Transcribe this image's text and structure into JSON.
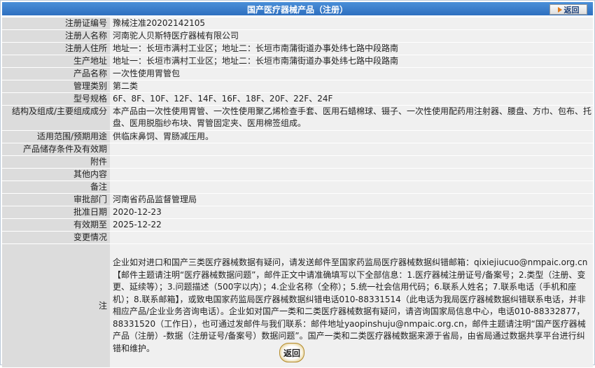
{
  "header": {
    "title": "国产医疗器械产品（注册）",
    "back_label": "返回"
  },
  "rows": [
    {
      "label": "注册证编号",
      "value": "豫械注准20202142105"
    },
    {
      "label": "注册人名称",
      "value": "河南驼人贝斯特医疗器械有限公司"
    },
    {
      "label": "注册人住所",
      "value": "地址一：长垣市满村工业区；地址二：长垣市南蒲街道办事处纬七路中段路南"
    },
    {
      "label": "生产地址",
      "value": "地址一：长垣市满村工业区；地址二：长垣市南蒲街道办事处纬七路中段路南"
    },
    {
      "label": "产品名称",
      "value": "一次性使用胃管包"
    },
    {
      "label": "管理类别",
      "value": "第二类"
    },
    {
      "label": "型号规格",
      "value": "6F、8F、10F、12F、14F、16F、18F、20F、22F、24F"
    },
    {
      "label": "结构及组成/主要组成成分",
      "value": "本产品由一次性使用胃管、一次性使用聚乙烯检查手套、医用石蜡棉球、镊子、一次性使用配药用注射器、腰盘、方巾、包布、托盘、医用脱脂纱布块、胃管固定夹、医用棉签组成。"
    },
    {
      "label": "适用范围/预期用途",
      "value": "供临床鼻饲、胃肠减压用。"
    },
    {
      "label": "产品储存条件及有效期",
      "value": ""
    },
    {
      "label": "附件",
      "value": ""
    },
    {
      "label": "其他内容",
      "value": ""
    },
    {
      "label": "备注",
      "value": ""
    },
    {
      "label": "审批部门",
      "value": "河南省药品监督管理局"
    },
    {
      "label": "批准日期",
      "value": "2020-12-23"
    },
    {
      "label": "有效期至",
      "value": "2025-12-22"
    },
    {
      "label": "变更情况",
      "value": ""
    }
  ],
  "note": {
    "label": "注",
    "text": "企业如对进口和国产三类医疗器械数据有疑问，请发送邮件至国家药监局医疗器械数据纠错邮箱：qixiejiucuo@nmpaic.org.cn【邮件主题请注明“医疗器械数据问题”，邮件正文中请准确填写以下全部信息：1.医疗器械注册证号/备案号；2.类型（注册、变更、延续等）；3.问题描述（500字以内）；4.企业名称（全称）；5.统一社会信用代码；6.联系人姓名；7.联系电话（手机和座机）；8.联系邮箱】，或致电国家药监局医疗器械数据纠错电话010-88331514（此电话为我局医疗器械数据纠错联系电话，并非相应产品/企业业务咨询电话）。企业如对国产一类和二类医疗器械数据有疑问，请咨询国家局信息中心，电话010-88332877，88331520（工作日），也可通过发邮件与我们联系：邮件地址yaopinshuju@nmpaic.org.cn，邮件主题请注明“国产医疗器械产品（注册）-数据（注册证号/备案号）数据问题”。国产一类和二类医疗器械数据来源于省局，由省局通过数据共享平台进行纠错和维护。"
  },
  "footer": {
    "back_label": "返回"
  }
}
